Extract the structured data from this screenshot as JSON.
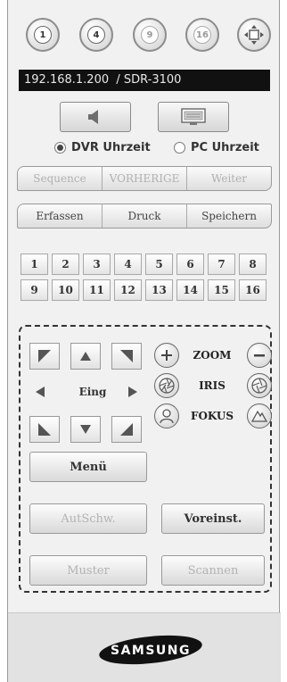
{
  "split_buttons": [
    {
      "label": "1",
      "style": "dark"
    },
    {
      "label": "4",
      "style": "dark"
    },
    {
      "label": "9",
      "style": "light"
    },
    {
      "label": "16",
      "style": "light"
    }
  ],
  "fullscreen_icon": "four-arrows-icon",
  "address_bar": {
    "text": "192.168.1.200  / SDR-3100"
  },
  "audio_button_icon": "speaker-icon",
  "display_button_icon": "monitor-icon",
  "time_source": {
    "dvr_label": "DVR Uhrzeit",
    "pc_label": "PC Uhrzeit",
    "selected": "dvr"
  },
  "nav_buttons": [
    "Sequence",
    "VORHERIGE",
    "Weiter"
  ],
  "action_buttons": [
    "Erfassen",
    "Druck",
    "Speichern"
  ],
  "channels": [
    "1",
    "2",
    "3",
    "4",
    "5",
    "6",
    "7",
    "8",
    "9",
    "10",
    "11",
    "12",
    "13",
    "14",
    "15",
    "16"
  ],
  "ptz": {
    "center_label": "Eing",
    "zoom_label": "ZOOM",
    "iris_label": "IRIS",
    "focus_label": "FOKUS",
    "menu_label": "Menü",
    "autoswing_label": "AutSchw.",
    "preset_label": "Voreinst.",
    "pattern_label": "Muster",
    "scan_label": "Scannen"
  },
  "footer": {
    "logo_text": "SAMSUNG"
  },
  "colors": {
    "panel": "#f1f1f1",
    "address_bg": "#111111",
    "footer_bg": "#e2e2e2"
  }
}
